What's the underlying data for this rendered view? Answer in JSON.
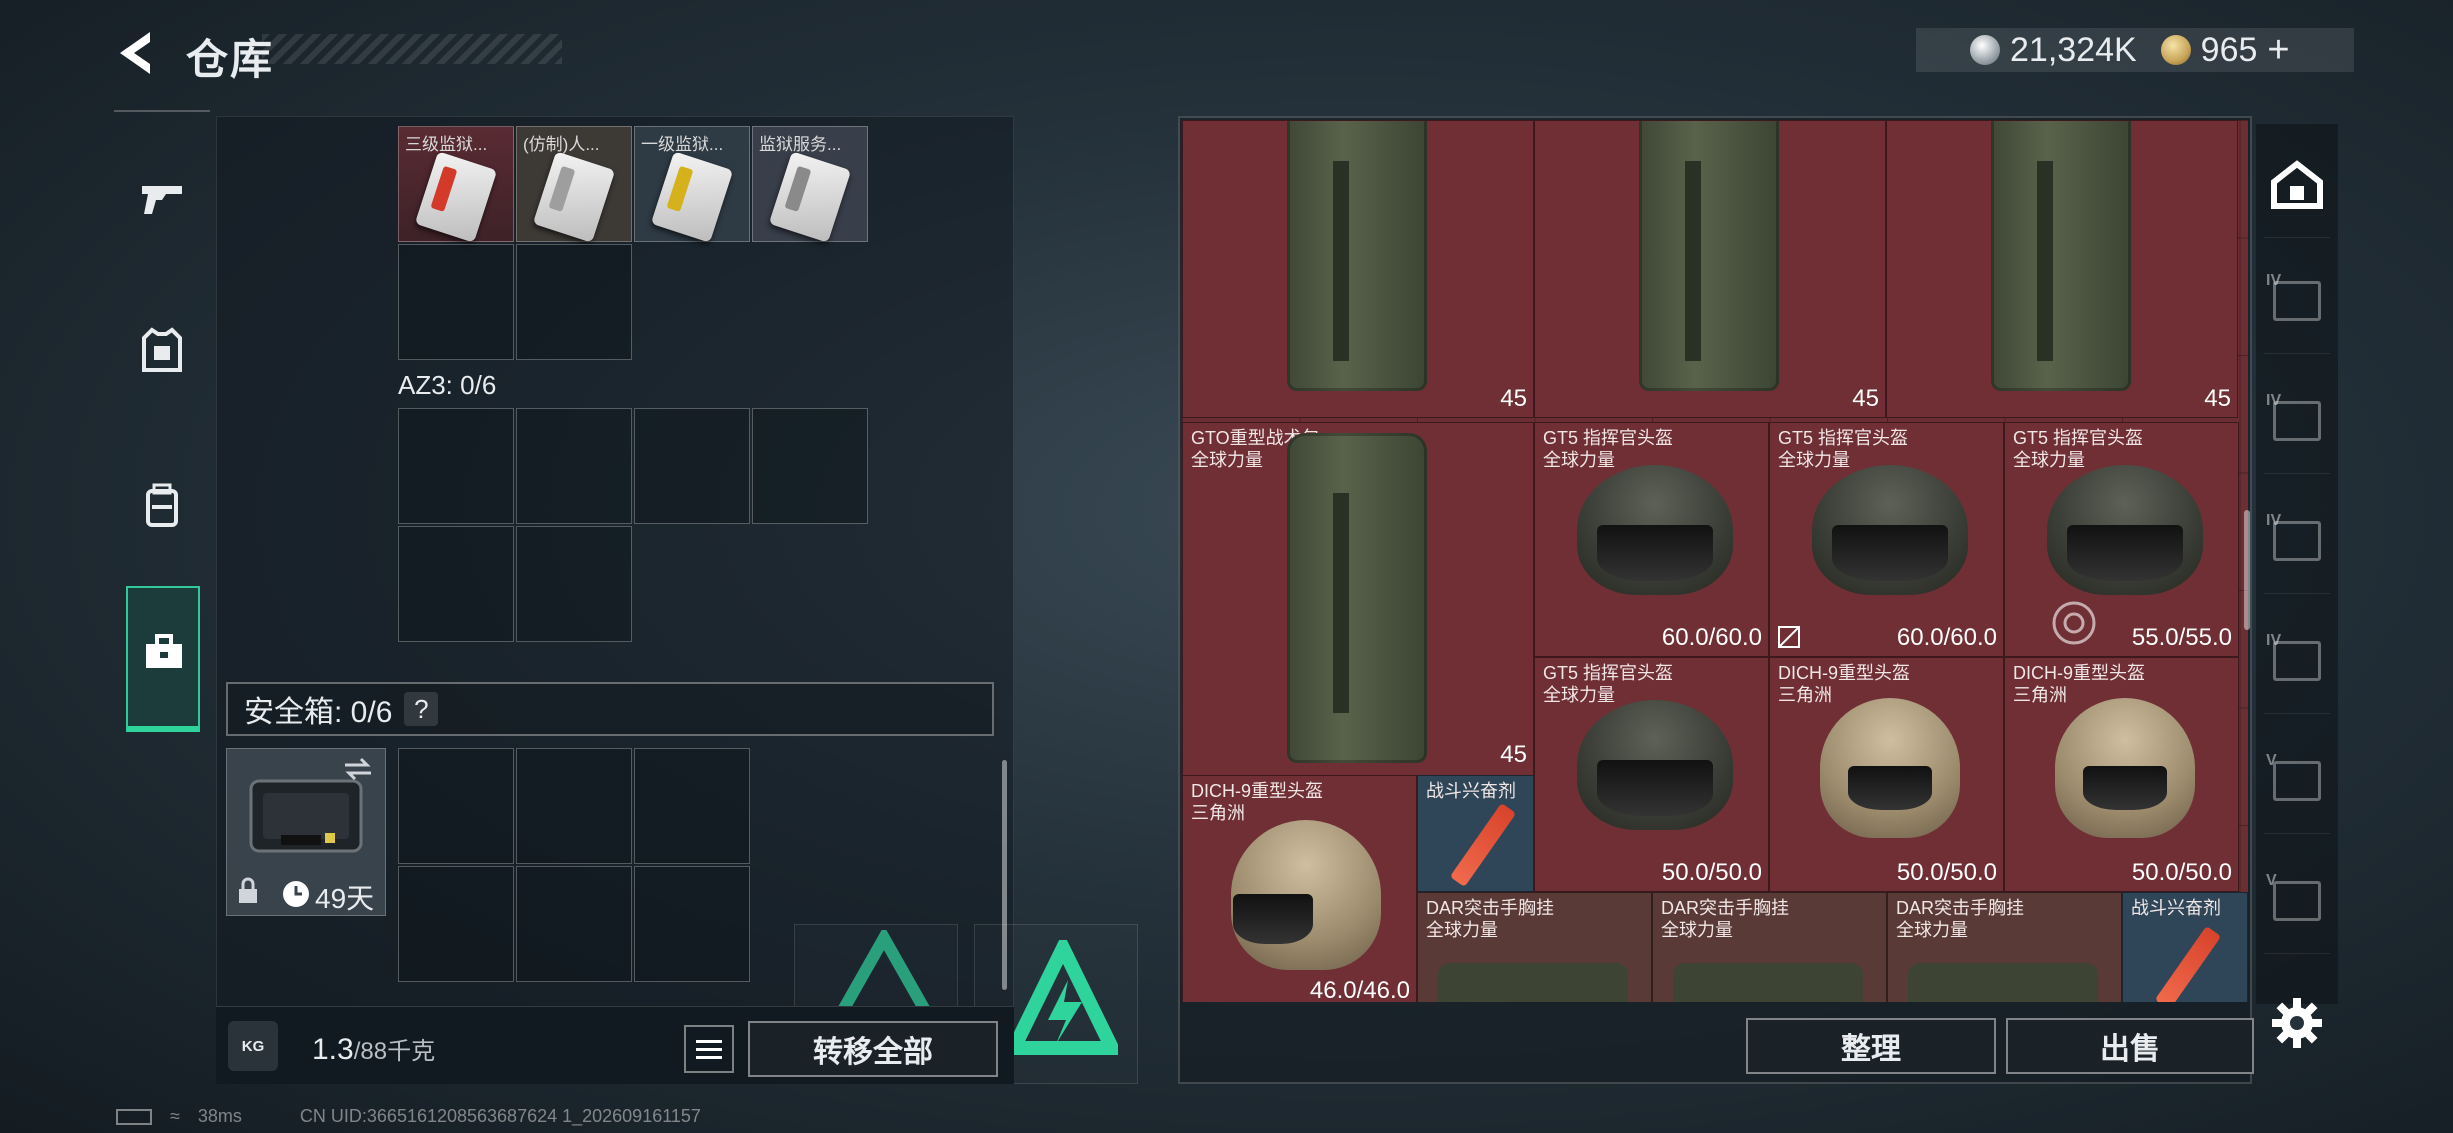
{
  "header": {
    "title": "仓库",
    "silver_amount": "21,324K",
    "gold_amount": "965",
    "plus_label": "+"
  },
  "left_panel": {
    "keycards": [
      {
        "label": "三级监狱...",
        "stripe": "#d33a2a"
      },
      {
        "label": "(仿制)人...",
        "stripe": "#9e9e9e"
      },
      {
        "label": "一级监狱...",
        "stripe": "#d5b21c"
      },
      {
        "label": "监狱服务...",
        "stripe": "#8a8a8a"
      }
    ],
    "az3_label": "AZ3: 0/6",
    "safe_box_label": "安全箱: 0/6",
    "safe_help": "?",
    "safe_days": "49天",
    "weight_icon": "KG",
    "weight_current": "1.3",
    "weight_unit": "/88千克",
    "transfer_all": "转移全部"
  },
  "stash": {
    "items": [
      {
        "name": "",
        "sub": "",
        "value": "45"
      },
      {
        "name": "",
        "sub": "",
        "value": "45"
      },
      {
        "name": "",
        "sub": "",
        "value": "45"
      },
      {
        "name": "GTO重型战术包",
        "sub": "全球力量",
        "value": "45"
      },
      {
        "name": "GT5 指挥官头盔",
        "sub": "全球力量",
        "value": "60.0/60.0"
      },
      {
        "name": "GT5 指挥官头盔",
        "sub": "全球力量",
        "value": "60.0/60.0"
      },
      {
        "name": "GT5 指挥官头盔",
        "sub": "全球力量",
        "value": "55.0/55.0"
      },
      {
        "name": "GT5 指挥官头盔",
        "sub": "全球力量",
        "value": "50.0/50.0"
      },
      {
        "name": "DICH-9重型头盔",
        "sub": "三角洲",
        "value": "50.0/50.0"
      },
      {
        "name": "DICH-9重型头盔",
        "sub": "三角洲",
        "value": "50.0/50.0"
      },
      {
        "name": "DICH-9重型头盔",
        "sub": "三角洲",
        "value": "46.0/46.0"
      },
      {
        "name": "战斗兴奋剂",
        "sub": "",
        "value": ""
      },
      {
        "name": "DAR突击手胸挂",
        "sub": "全球力量",
        "value": ""
      },
      {
        "name": "DAR突击手胸挂",
        "sub": "全球力量",
        "value": ""
      },
      {
        "name": "DAR突击手胸挂",
        "sub": "全球力量",
        "value": ""
      },
      {
        "name": "战斗兴奋剂",
        "sub": "",
        "value": ""
      }
    ],
    "sort_button": "整理",
    "sell_button": "出售"
  },
  "right_rail": {
    "tabs": [
      "IV",
      "IV",
      "IV",
      "IV",
      "V",
      "V"
    ]
  },
  "footer": {
    "ping": "38ms",
    "uid": "CN UID:3665161208563687624 1_202609161157"
  },
  "colors": {
    "accent_green": "#2fd39c",
    "stash_red": "#6a2e33"
  }
}
